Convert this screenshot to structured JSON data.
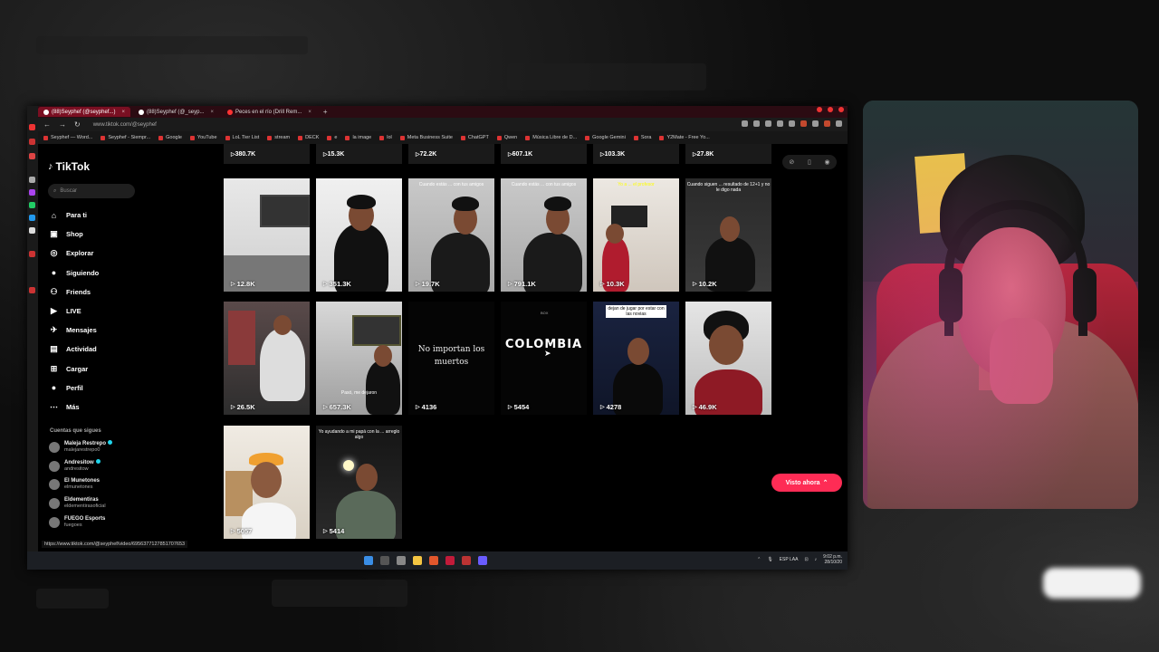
{
  "browser": {
    "tabs": [
      {
        "label": "(88)Seyphef (@seyphef...)",
        "active": true
      },
      {
        "label": "(88)Seyphef (@_seyp...",
        "active": false
      },
      {
        "label": "Peces en el río (Drill Rem...",
        "active": false
      }
    ],
    "new_tab": "+",
    "url": "www.tiktok.com/@seyphef",
    "nav": {
      "back": "←",
      "forward": "→",
      "reload": "↻"
    },
    "bookmarks": [
      "Seyphef — Word...",
      "Seyphef - Siempr...",
      "Google",
      "YouTube",
      "LoL Tier List",
      "stream",
      "DECK",
      "e",
      "la image",
      "lol",
      "Meta Business Suite",
      "ChatGPT",
      "Qwen",
      "Música Libre de D...",
      "Google Gemini",
      "Sora",
      "Y2Mate - Free Yo..."
    ]
  },
  "sidebar": {
    "logo": "TikTok",
    "search_placeholder": "Buscar",
    "items": [
      {
        "label": "Para ti",
        "icon": "home-icon",
        "glyph": "⌂"
      },
      {
        "label": "Shop",
        "icon": "shop-bag-icon",
        "glyph": "▣"
      },
      {
        "label": "Explorar",
        "icon": "compass-icon",
        "glyph": "◎"
      },
      {
        "label": "Siguiendo",
        "icon": "following-avatar-icon",
        "glyph": "●"
      },
      {
        "label": "Friends",
        "icon": "friends-icon",
        "glyph": "⚇"
      },
      {
        "label": "LIVE",
        "icon": "live-icon",
        "glyph": "▶"
      },
      {
        "label": "Mensajes",
        "icon": "messages-icon",
        "glyph": "✈"
      },
      {
        "label": "Actividad",
        "icon": "activity-icon",
        "glyph": "▤"
      },
      {
        "label": "Cargar",
        "icon": "upload-icon",
        "glyph": "⊞"
      },
      {
        "label": "Perfil",
        "icon": "profile-icon",
        "glyph": "●"
      },
      {
        "label": "Más",
        "icon": "more-icon",
        "glyph": "⋯"
      }
    ],
    "following_title": "Cuentas que sigues",
    "following": [
      {
        "name": "Maleja Restrepo",
        "handle": "malejarestrepo0",
        "verified": true
      },
      {
        "name": "Andresitow",
        "handle": "andresitow",
        "verified": true
      },
      {
        "name": "El Munetones",
        "handle": "elmunetones",
        "verified": false
      },
      {
        "name": "Eldementiras",
        "handle": "eldementirasoficial",
        "verified": false
      },
      {
        "name": "FUEGO Esports",
        "handle": "fuegoes",
        "verified": false
      }
    ],
    "hover_url": "https://www.tiktok.com/@seyphef/video/6956377127851707653"
  },
  "grid": {
    "top_row_counts": [
      "380.7K",
      "15.3K",
      "72.2K",
      "607.1K",
      "103.3K",
      "27.8K"
    ],
    "row1": [
      {
        "count": "12.8K",
        "overlay": ""
      },
      {
        "count": "351.3K",
        "overlay": ""
      },
      {
        "count": "19.7K",
        "overlay": "Cuando estás ... con tus amigos"
      },
      {
        "count": "791.1K",
        "overlay": "Cuando estás ... con tus amigos"
      },
      {
        "count": "10.3K",
        "overlay": "Yo a ... el profesor"
      },
      {
        "count": "10.2K",
        "overlay": "Cuando siguen ... resultado de 12+1 y no le digo nada"
      }
    ],
    "row2": [
      {
        "count": "26.5K",
        "overlay": ""
      },
      {
        "count": "657.3K",
        "overlay": "Pasó, me dejaron"
      },
      {
        "count": "4136",
        "overlay": "No importan los muertos"
      },
      {
        "count": "5454",
        "overlay": "COLOMBIA"
      },
      {
        "count": "4278",
        "overlay": "dejan de jugar por estar con las novias"
      },
      {
        "count": "46.9K",
        "overlay": ""
      }
    ],
    "row3": [
      {
        "count": "5057",
        "overlay": ""
      },
      {
        "count": "5414",
        "overlay": "Yo ayudando a mi papá con la ... arreglo algo"
      }
    ]
  },
  "visto_button": "Visto ahora",
  "taskbar": {
    "lang": "ESP LAA",
    "time": "9:02 p.m.",
    "date": "28/10/20"
  },
  "colors": {
    "tiktok_red": "#fe2c55",
    "tab_active": "#7a0f22"
  }
}
